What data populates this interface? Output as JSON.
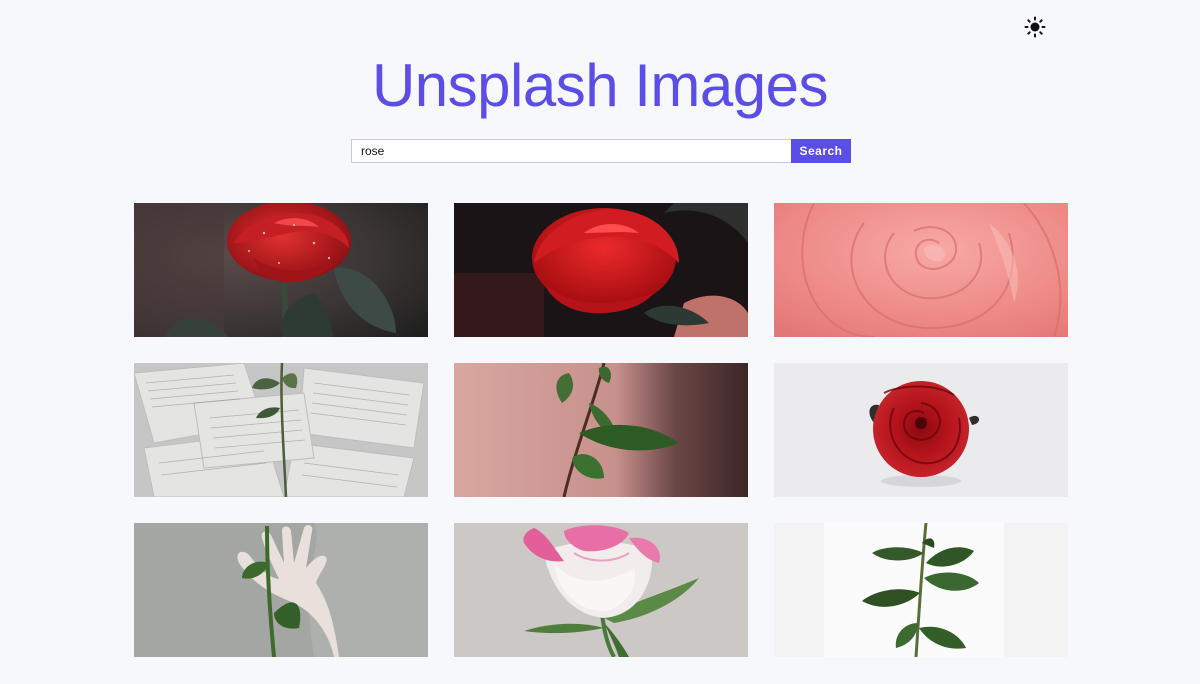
{
  "header": {
    "title": "Unsplash Images",
    "theme_toggle_icon": "sun-icon"
  },
  "search": {
    "value": "rose",
    "placeholder": "",
    "button_label": "Search"
  },
  "colors": {
    "accent": "#5b4de8",
    "background": "#f7f8fb"
  },
  "results": [
    {
      "id": "rose-dark-dew",
      "description": "red rose with water drops on dark background"
    },
    {
      "id": "rose-red-leaves",
      "description": "red rose with dark leaves"
    },
    {
      "id": "rose-pink-petals",
      "description": "close-up of pink rose petals"
    },
    {
      "id": "rose-on-books",
      "description": "rose stem on open book pages"
    },
    {
      "id": "rose-stem-pink-wall",
      "description": "rose stem with leaves against pink wall"
    },
    {
      "id": "rose-red-white-bg",
      "description": "red rose head on white background"
    },
    {
      "id": "rose-hand-stem",
      "description": "hand holding rose stem"
    },
    {
      "id": "rose-pink-white",
      "description": "pink and white rose"
    },
    {
      "id": "rose-stem-white",
      "description": "rose stem with leaves on white"
    }
  ]
}
